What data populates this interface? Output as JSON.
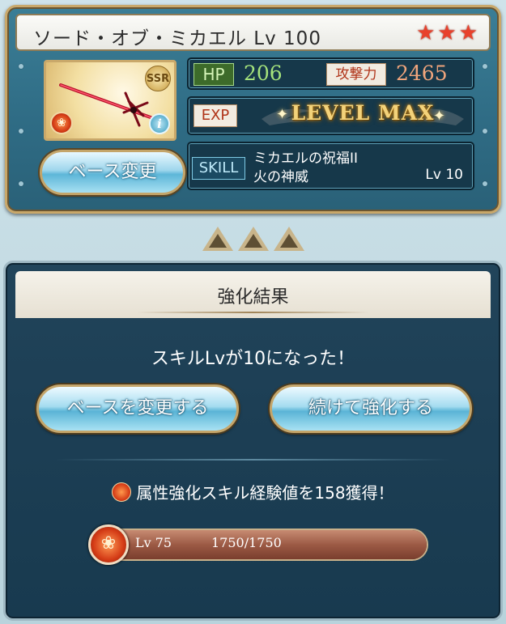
{
  "weapon": {
    "title": "ソード・オブ・ミカエル Lv 100",
    "rarity_stars": 3,
    "rarity_badge": "SSR",
    "element": "fire",
    "star_color": "#e8412c"
  },
  "stats": {
    "hp_label": "HP",
    "hp_value": "206",
    "atk_label": "攻撃力",
    "atk_value": "2465",
    "exp_label": "EXP",
    "exp_status": "LEVEL MAX"
  },
  "skill": {
    "label": "SKILL",
    "name": "ミカエルの祝福II",
    "name_line2": "火の神威",
    "level": "Lv 10"
  },
  "buttons": {
    "base_change": "ベース変更",
    "base_change_full": "ベースを変更する",
    "continue_upgrade": "続けて強化する"
  },
  "result": {
    "title": "強化結果",
    "message": "スキルLvが10になった！",
    "exp_gain": "属性強化スキル経験値を158獲得！",
    "element_level": "Lv 75",
    "element_progress": "1750/1750",
    "element_progress_fraction": 1.0
  },
  "icons": {
    "star": "★",
    "fire": "❀",
    "info": "i"
  }
}
